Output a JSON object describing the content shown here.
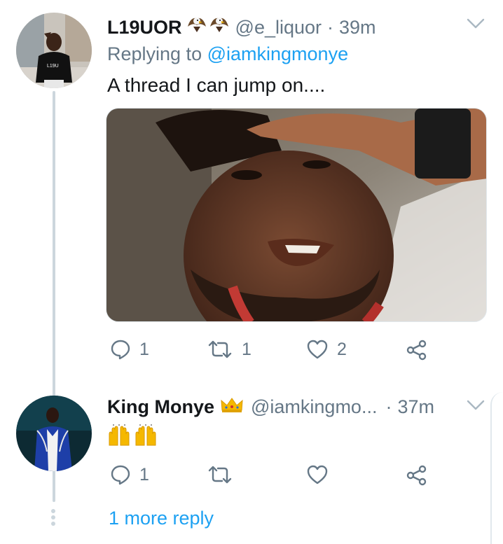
{
  "tweet1": {
    "display_name": "L19UOR",
    "handle": "@e_liquor",
    "separator": "·",
    "time": "39m",
    "name_emojis": [
      "eagle-emoji",
      "eagle-emoji"
    ],
    "replying_prefix": "Replying to ",
    "replying_handle": "@iamkingmonye",
    "text": "A thread I can jump on....",
    "avatar_shirt_text": "L19U",
    "actions": {
      "reply_count": "1",
      "retweet_count": "1",
      "like_count": "2"
    }
  },
  "tweet2": {
    "display_name": "King Monye",
    "name_emoji": "crown-emoji",
    "handle": "@iamkingmo...",
    "separator": "·",
    "time": "37m",
    "text_emojis": [
      "raising-hands-emoji",
      "raising-hands-emoji"
    ],
    "actions": {
      "reply_count": "1",
      "retweet_count": "",
      "like_count": ""
    }
  },
  "more_replies_label": "1 more reply",
  "icons": {
    "reply": "reply-icon",
    "retweet": "retweet-icon",
    "like": "heart-icon",
    "share": "share-icon",
    "menu": "chevron-down-icon"
  },
  "colors": {
    "link": "#1da1f2",
    "secondary_text": "#657786",
    "primary_text": "#14171a",
    "thread_line": "#ccd6dd"
  }
}
